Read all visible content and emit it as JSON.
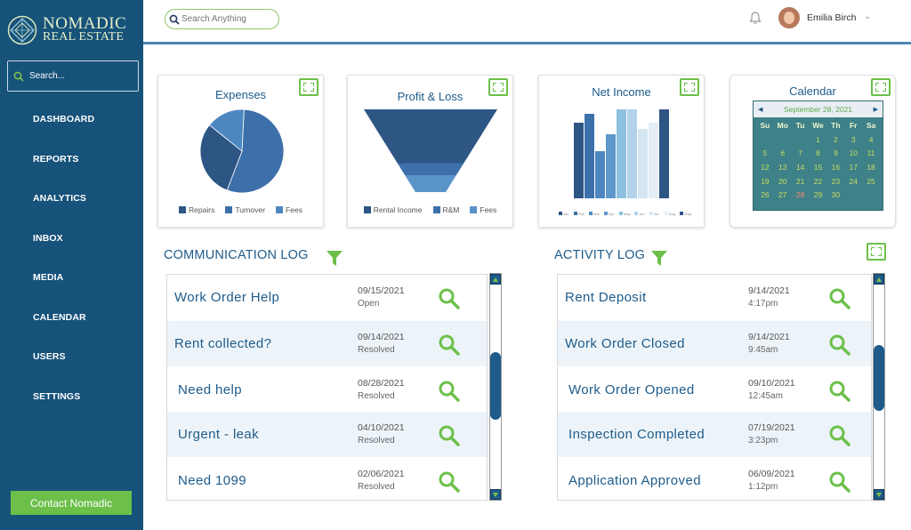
{
  "brand": {
    "line1": "NOMADIC",
    "line2": "REAL ESTATE"
  },
  "sidebar": {
    "search_placeholder": "Search...",
    "items": [
      {
        "label": "DASHBOARD"
      },
      {
        "label": "REPORTS"
      },
      {
        "label": "ANALYTICS"
      },
      {
        "label": "INBOX"
      },
      {
        "label": "MEDIA"
      },
      {
        "label": "CALENDAR"
      },
      {
        "label": "USERS"
      },
      {
        "label": "SETTINGS"
      }
    ],
    "contact_label": "Contact Nomadic"
  },
  "header": {
    "search_placeholder": "Search Anything",
    "user_name": "Emilia Birch"
  },
  "colors": {
    "sidebar": "#16527a",
    "accent_green": "#6cc04a",
    "title_blue": "#1e5b8a"
  },
  "widgets": {
    "expenses": {
      "title": "Expenses",
      "chart_data": {
        "type": "pie",
        "series": [
          {
            "name": "Repairs",
            "value": 30,
            "color": "#2d5685"
          },
          {
            "name": "Turnover",
            "value": 55,
            "color": "#3d70aa"
          },
          {
            "name": "Fees",
            "value": 15,
            "color": "#4d87c2"
          }
        ]
      }
    },
    "profit_loss": {
      "title": "Profit & Loss",
      "chart_data": {
        "type": "funnel",
        "series": [
          {
            "name": "Rental Income",
            "value": 65,
            "color": "#2d5685"
          },
          {
            "name": "R&M",
            "value": 15,
            "color": "#3d70aa"
          },
          {
            "name": "Fees",
            "value": 20,
            "color": "#5a93c8"
          }
        ]
      }
    },
    "net_income": {
      "title": "Net Income",
      "chart_data": {
        "type": "bar",
        "categories": [
          "Jan",
          "Feb",
          "Mar",
          "Apr",
          "May",
          "Jun",
          "Jul",
          "Aug",
          "Sept"
        ],
        "values": [
          85,
          95,
          53,
          72,
          100,
          100,
          78,
          85,
          100
        ],
        "colors": [
          "#2d5685",
          "#3d70aa",
          "#4d87c2",
          "#5f97ca",
          "#8ec0e0",
          "#b3d2ea",
          "#d5e6f3",
          "#e4eef7",
          "#2d5685"
        ],
        "ylim": [
          0,
          100
        ]
      }
    },
    "calendar": {
      "title": "Calendar",
      "month_label": "September 28, 2021",
      "days_of_week": [
        "Su",
        "Mo",
        "Tu",
        "We",
        "Th",
        "Fr",
        "Sa"
      ],
      "leading_blanks": 3,
      "days_in_month": 30,
      "today": 28
    }
  },
  "communication_log": {
    "title": "COMMUNICATION LOG",
    "rows": [
      {
        "title": "Work Order Help",
        "date": "09/15/2021",
        "status": "Open"
      },
      {
        "title": "Rent collected?",
        "date": "09/14/2021",
        "status": "Resolved"
      },
      {
        "title": "Need help",
        "date": "08/28/2021",
        "status": "Resolved"
      },
      {
        "title": "Urgent - leak",
        "date": "04/10/2021",
        "status": "Resolved"
      },
      {
        "title": "Need 1099",
        "date": "02/06/2021",
        "status": "Resolved"
      }
    ]
  },
  "activity_log": {
    "title": "ACTIVITY LOG",
    "rows": [
      {
        "title": "Rent Deposit",
        "date": "9/14/2021",
        "status": "4:17pm"
      },
      {
        "title": "Work Order Closed",
        "date": "9/14/2021",
        "status": "9:45am"
      },
      {
        "title": "Work Order Opened",
        "date": "09/10/2021",
        "status": "12:45am"
      },
      {
        "title": "Inspection Completed",
        "date": "07/19/2021",
        "status": "3:23pm"
      },
      {
        "title": "Application Approved",
        "date": "06/09/2021",
        "status": "1:12pm"
      }
    ]
  }
}
